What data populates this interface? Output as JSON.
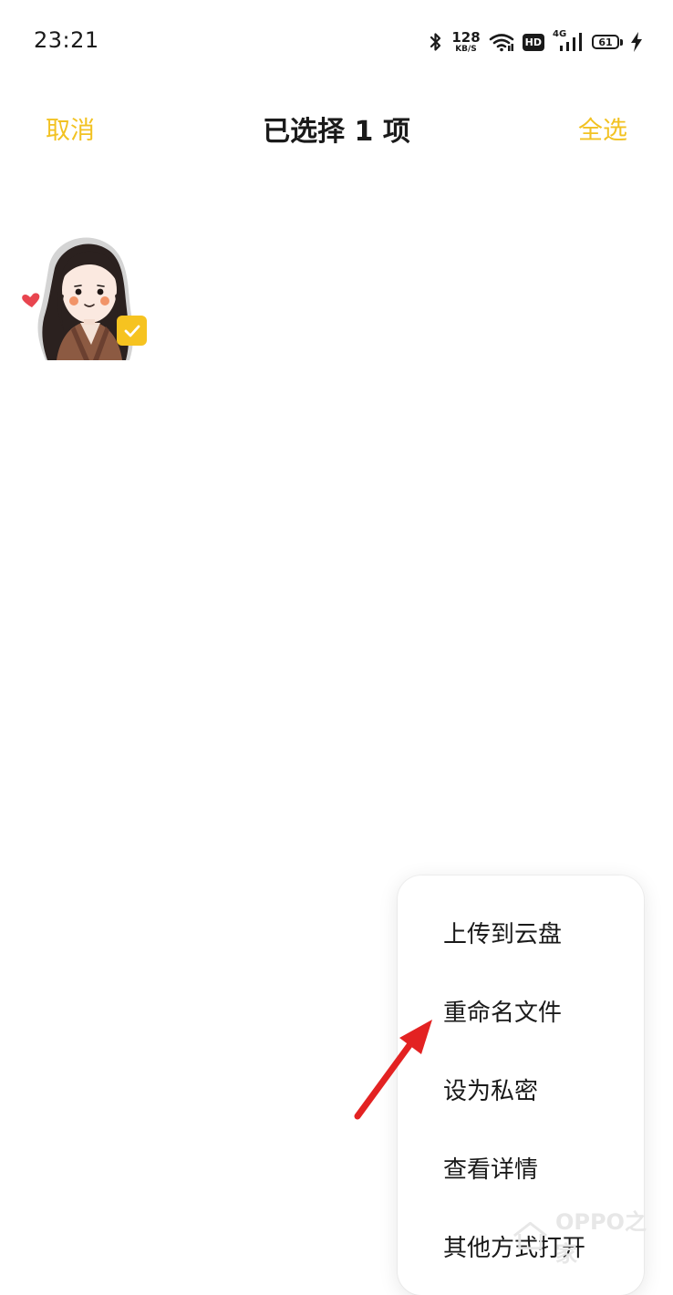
{
  "status_bar": {
    "time": "23:21",
    "speed_value": "128",
    "speed_unit": "KB/S",
    "hd_label": "HD",
    "network_label": "4G",
    "battery_level": "61"
  },
  "header": {
    "cancel_label": "取消",
    "title": "已选择 1 项",
    "select_all_label": "全选"
  },
  "selection": {
    "checked": true
  },
  "menu": {
    "items": [
      "上传到云盘",
      "重命名文件",
      "设为私密",
      "查看详情",
      "其他方式打开"
    ]
  },
  "watermark": {
    "text": "OPPO之家"
  },
  "colors": {
    "accent": "#f2c222",
    "check_bg": "#f6c320",
    "arrow": "#e32222"
  }
}
